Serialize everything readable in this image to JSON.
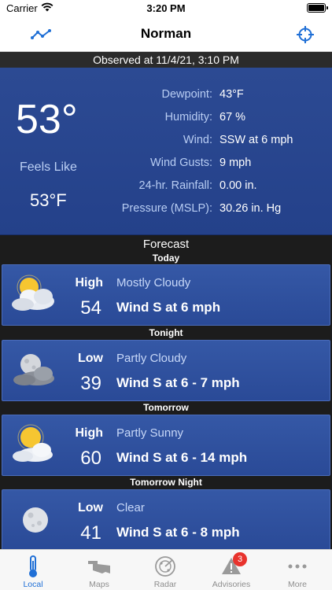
{
  "status_bar": {
    "carrier": "Carrier",
    "time": "3:20 PM"
  },
  "nav": {
    "title": "Norman",
    "left_icon": "trend-icon",
    "right_icon": "locate-icon"
  },
  "observed": "Observed at 11/4/21, 3:10 PM",
  "current": {
    "temperature": "53°",
    "feels_like_label": "Feels Like",
    "feels_like_value": "53°F",
    "details": [
      {
        "label": "Dewpoint:",
        "value": "43°F"
      },
      {
        "label": "Humidity:",
        "value": "67  %"
      },
      {
        "label": "Wind:",
        "value": "SSW at 6  mph"
      },
      {
        "label": "Wind Gusts:",
        "value": "9  mph"
      },
      {
        "label": "24-hr. Rainfall:",
        "value": "0.00 in."
      },
      {
        "label": "Pressure (MSLP):",
        "value": "30.26 in. Hg"
      }
    ]
  },
  "forecast": {
    "title": "Forecast",
    "periods": [
      {
        "period": "Today",
        "hl_label": "High",
        "temp": "54",
        "condition": "Mostly Cloudy",
        "wind": "Wind S at 6 mph",
        "icon": "mostly-cloudy-icon"
      },
      {
        "period": "Tonight",
        "hl_label": "Low",
        "temp": "39",
        "condition": "Partly Cloudy",
        "wind": "Wind S at 6 - 7 mph",
        "icon": "partly-cloudy-night-icon"
      },
      {
        "period": "Tomorrow",
        "hl_label": "High",
        "temp": "60",
        "condition": "Partly Sunny",
        "wind": "Wind S at 6 - 14 mph",
        "icon": "partly-sunny-icon"
      },
      {
        "period": "Tomorrow Night",
        "hl_label": "Low",
        "temp": "41",
        "condition": "Clear",
        "wind": "Wind S at 6 - 8 mph",
        "icon": "clear-night-icon"
      }
    ]
  },
  "tabs": [
    {
      "label": "Local",
      "icon": "thermometer-icon",
      "active": true
    },
    {
      "label": "Maps",
      "icon": "map-icon"
    },
    {
      "label": "Radar",
      "icon": "radar-icon"
    },
    {
      "label": "Advisories",
      "icon": "warning-icon",
      "badge": "3"
    },
    {
      "label": "More",
      "icon": "more-icon"
    }
  ],
  "colors": {
    "accent": "#1f6fd6",
    "panel": "#2c4a93",
    "card": "#3558a6",
    "badge": "#e8332d"
  }
}
